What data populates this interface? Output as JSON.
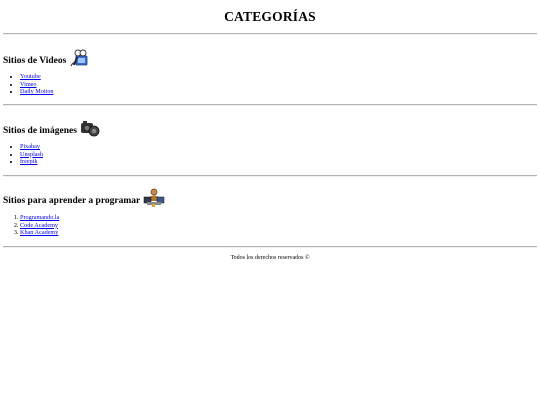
{
  "page": {
    "title": "CATEGORÍAS"
  },
  "sections": [
    {
      "heading": "Sitios de Videos",
      "icon": "video-camera-icon",
      "list_type": "unordered",
      "links": [
        "Youtube",
        "Vimeo",
        "Daily Motion"
      ]
    },
    {
      "heading": "Sitios de imágenes",
      "icon": "photo-camera-icon",
      "list_type": "unordered",
      "links": [
        "Pixabay",
        "Unsplash",
        "freepik"
      ]
    },
    {
      "heading": "Sitios para aprender a programar",
      "icon": "programmer-icon",
      "list_type": "ordered",
      "links": [
        "Programando.la",
        "Code Academy",
        "Khan Academy"
      ]
    }
  ],
  "footer": {
    "text": "Todos los derechos reservados ©"
  },
  "colors": {
    "link": "#0000ee",
    "divider": "#b3b3b3"
  }
}
